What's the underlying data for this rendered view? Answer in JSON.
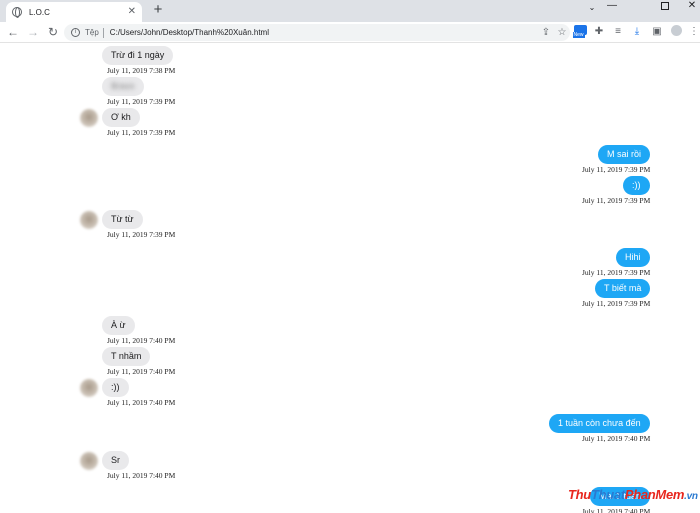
{
  "browser": {
    "tab_title": "L.O.C",
    "tab_close": "✕",
    "new_tab": "+",
    "scheme_label": "Tệp",
    "url": "C:/Users/John/Desktop/Thanh%20Xuân.html",
    "extension_badge": "New"
  },
  "messages": [
    {
      "side": "in",
      "text": "Trừ đi 1 ngày",
      "time": "July 11, 2019 7:38 PM"
    },
    {
      "side": "in",
      "text": "Bravo",
      "time": "July 11, 2019 7:39 PM",
      "blurred": true
    },
    {
      "side": "in",
      "text": "Ơ kh",
      "time": "July 11, 2019 7:39 PM",
      "avatar": true
    },
    {
      "side": "out",
      "text": "M sai rồi",
      "time": "July 11, 2019 7:39 PM"
    },
    {
      "side": "out",
      "text": ":))",
      "time": "July 11, 2019 7:39 PM"
    },
    {
      "side": "in",
      "text": "Từ từ",
      "time": "July 11, 2019 7:39 PM",
      "avatar": true
    },
    {
      "side": "out",
      "text": "Hihi",
      "time": "July 11, 2019 7:39 PM"
    },
    {
      "side": "out",
      "text": "T biết mà",
      "time": "July 11, 2019 7:39 PM"
    },
    {
      "side": "in",
      "text": "À ừ",
      "time": "July 11, 2019 7:40 PM"
    },
    {
      "side": "in",
      "text": "T nhầm",
      "time": "July 11, 2019 7:40 PM"
    },
    {
      "side": "in",
      "text": ":))",
      "time": "July 11, 2019 7:40 PM",
      "avatar": true
    },
    {
      "side": "out",
      "text": "1 tuần còn chưa đến",
      "time": "July 11, 2019 7:40 PM"
    },
    {
      "side": "in",
      "text": "Sr",
      "time": "July 11, 2019 7:40 PM",
      "avatar": true
    },
    {
      "side": "out",
      "text": "Mai 1 tuần",
      "time": "July 11, 2019 7:40 PM"
    }
  ],
  "watermark": {
    "part1": "Thu",
    "part2": "Thuat",
    "part3": "PhanMem",
    "part4": ".vn"
  }
}
